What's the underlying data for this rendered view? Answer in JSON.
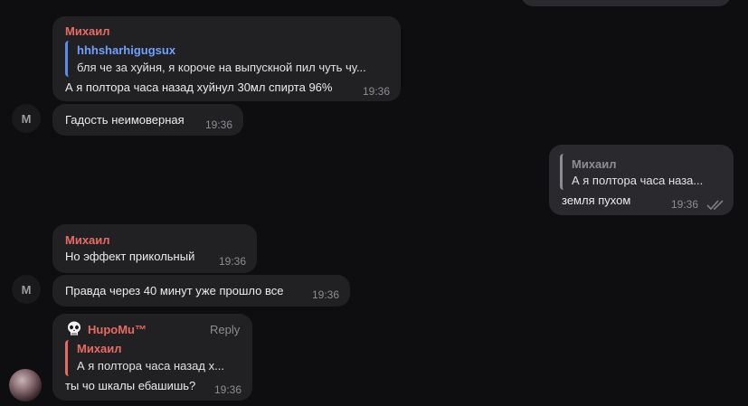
{
  "colors": {
    "background": "#0e0e10",
    "bubble": "#212124",
    "bubble_outgoing": "#2a2a2e",
    "sender_red": "#e86b63",
    "reply_blue": "#5b8cf0",
    "reply_blue_name": "#6fa0ff",
    "muted": "#8c8c92"
  },
  "messages": [
    {
      "sender": "Михаил",
      "reply": {
        "name": "hhhsharhigugsux",
        "text": "бля че за хуйня, я короче на выпускной пил чуть чу..."
      },
      "text": "А я полтора часа назад хуйнул 30мл спирта 96%",
      "time": "19:36"
    },
    {
      "avatar_initial": "M",
      "text": "Гадость неимоверная",
      "time": "19:36"
    },
    {
      "reply": {
        "name": "Михаил",
        "text": "А я полтора часа наза..."
      },
      "text": "земля пухом",
      "time": "19:36",
      "status_icon": "double-check-icon"
    },
    {
      "sender": "Михаил",
      "text": "Но эффект прикольный",
      "time": "19:36"
    },
    {
      "avatar_initial": "M",
      "text": "Правда через 40 минут уже прошло все",
      "time": "19:36"
    },
    {
      "sender_icon": "skull-icon",
      "sender": "HupoMu™",
      "reply_action": "Reply",
      "reply": {
        "name": "Михаил",
        "text": "А я полтора часа назад х..."
      },
      "text": "ты чо шкалы ебашишь?",
      "time": "19:36",
      "avatar": "user-avatar-photo"
    }
  ]
}
